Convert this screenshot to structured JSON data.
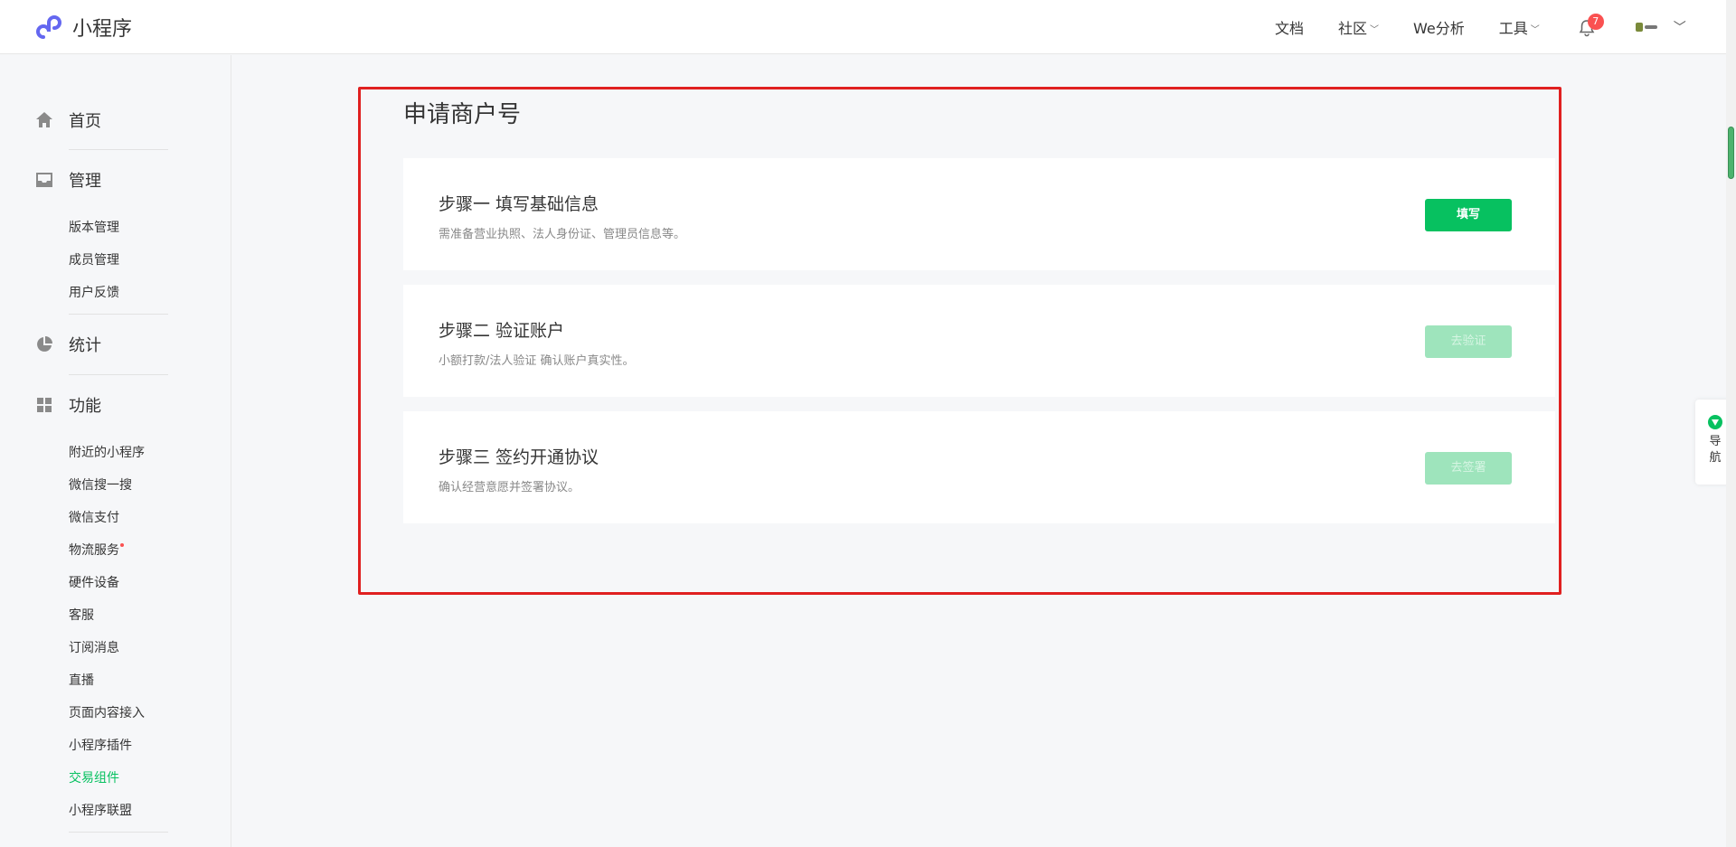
{
  "header": {
    "app_name": "小程序",
    "nav": [
      {
        "label": "文档",
        "has_caret": false
      },
      {
        "label": "社区",
        "has_caret": true
      },
      {
        "label": "We分析",
        "has_caret": false
      },
      {
        "label": "工具",
        "has_caret": true
      }
    ],
    "notification_count": "7",
    "icons": {
      "logo": "miniprogram-logo-icon",
      "bell": "bell-icon",
      "account_caret": "chevron-down-icon"
    }
  },
  "sidebar": {
    "home": {
      "label": "首页",
      "icon": "home-icon"
    },
    "manage": {
      "label": "管理",
      "icon": "inbox-icon",
      "items": [
        "版本管理",
        "成员管理",
        "用户反馈"
      ]
    },
    "stats": {
      "label": "统计",
      "icon": "pie-chart-icon"
    },
    "features": {
      "label": "功能",
      "icon": "grid-icon",
      "items": [
        "附近的小程序",
        "微信搜一搜",
        "微信支付",
        "物流服务",
        "硬件设备",
        "客服",
        "订阅消息",
        "直播",
        "页面内容接入",
        "小程序插件",
        "交易组件",
        "小程序联盟"
      ],
      "active_item": "交易组件",
      "dot_item": "物流服务"
    }
  },
  "main": {
    "title": "申请商户号",
    "steps": [
      {
        "title": "步骤一 填写基础信息",
        "desc": "需准备营业执照、法人身份证、管理员信息等。",
        "button": "填写",
        "enabled": true
      },
      {
        "title": "步骤二 验证账户",
        "desc": "小额打款/法人验证 确认账户真实性。",
        "button": "去验证",
        "enabled": false
      },
      {
        "title": "步骤三 签约开通协议",
        "desc": "确认经营意愿并签署协议。",
        "button": "去签署",
        "enabled": false
      }
    ]
  },
  "float_nav": {
    "label_1": "导",
    "label_2": "航",
    "icon": "navigation-icon"
  },
  "colors": {
    "primary": "#07c160",
    "primary_disabled": "#9ee4bc",
    "badge": "#fa5151",
    "highlight_border": "#e02020"
  }
}
